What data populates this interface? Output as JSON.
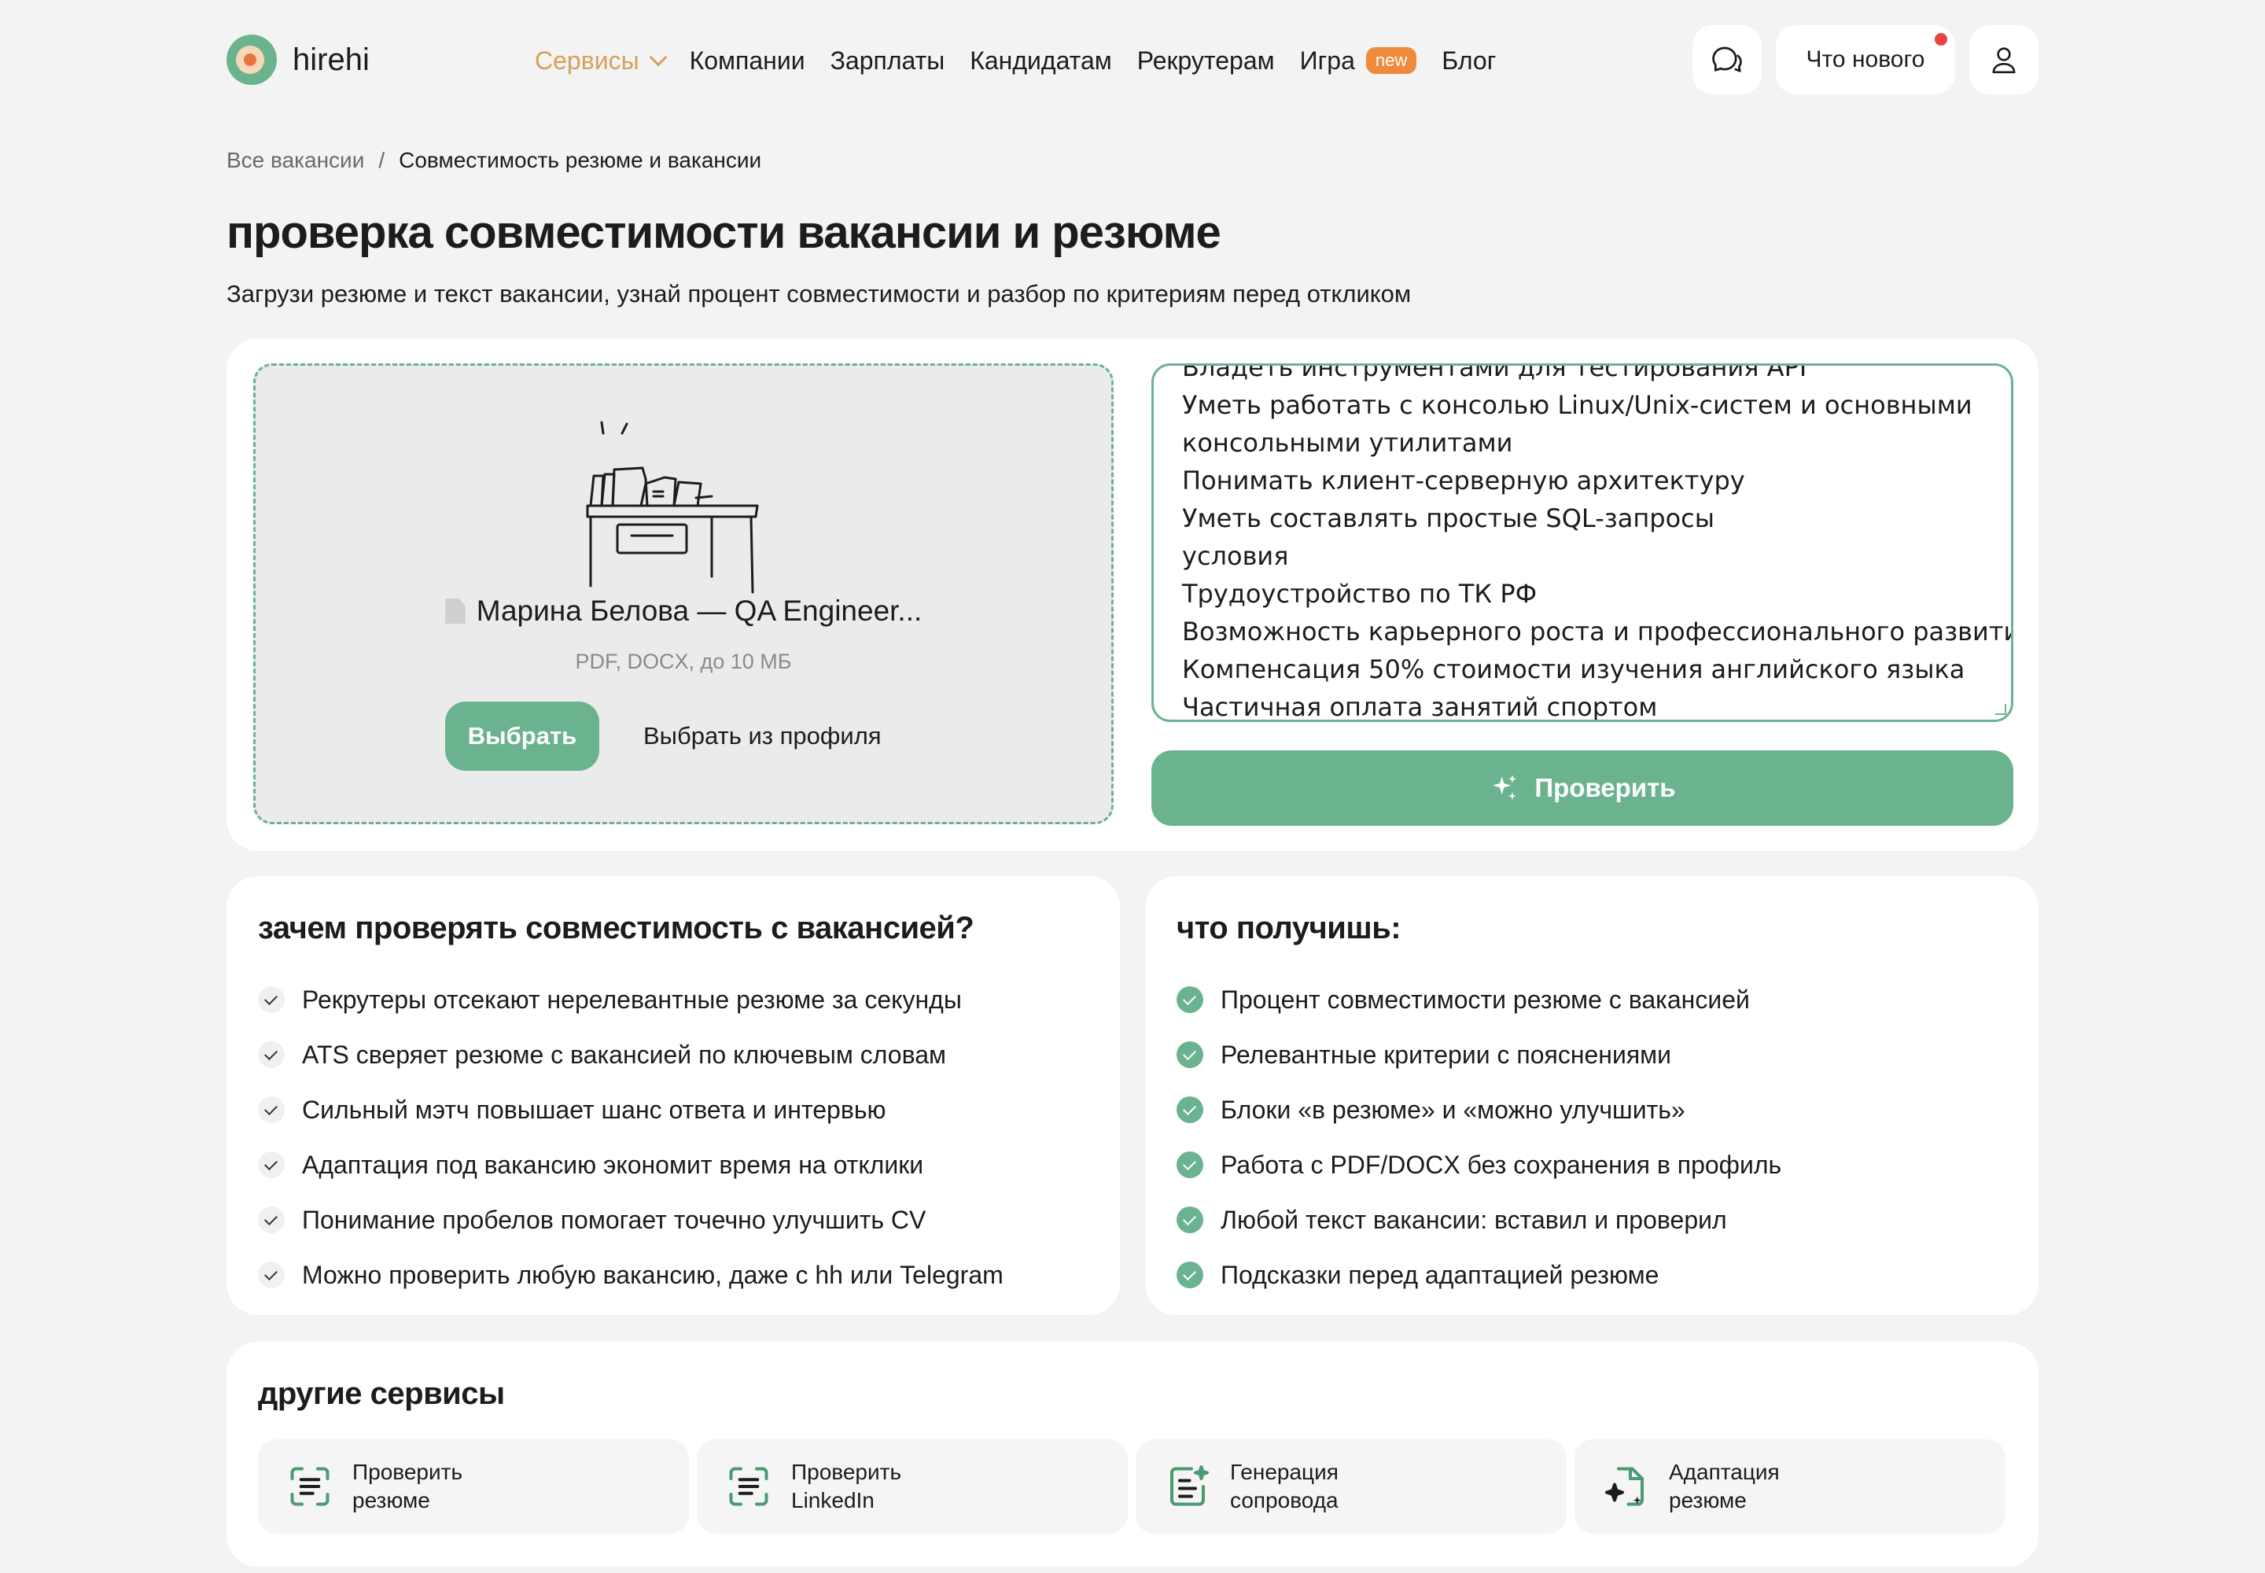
{
  "brand": {
    "name": "hirehi"
  },
  "nav": {
    "items": [
      {
        "label": "Сервисы",
        "active": true
      },
      {
        "label": "Компании"
      },
      {
        "label": "Зарплаты"
      },
      {
        "label": "Кандидатам"
      },
      {
        "label": "Рекрутерам"
      },
      {
        "label": "Игра",
        "badge": "new"
      },
      {
        "label": "Блог"
      }
    ],
    "whats_new": "Что нового"
  },
  "breadcrumb": {
    "root": "Все вакансии",
    "separator": "/",
    "current": "Совместимость резюме и вакансии"
  },
  "page": {
    "title": "проверка совместимости вакансии и резюме",
    "subtitle": "Загрузи резюме и текст вакансии, узнай процент совместимости и разбор по критериям перед откликом"
  },
  "upload": {
    "file_name": "Марина Белова — QA Engineer...",
    "hint": "PDF, DOCX, до 10 МБ",
    "choose_label": "Выбрать",
    "choose_profile_label": "Выбрать из профиля"
  },
  "vacancy_text": {
    "lines": [
      "Владеть инструментами для тестирования API",
      "Уметь работать с консолью Linux/Unix-систем и основными",
      "консольными утилитами",
      "Понимать клиент-серверную архитектуру",
      "Уметь составлять простые SQL-запросы",
      "условия",
      "Трудоустройство по ТК РФ",
      "Возможность карьерного роста и профессионального развития",
      "Компенсация 50% стоимости изучения английского языка",
      "Частичная оплата занятий спортом"
    ]
  },
  "check_button": {
    "label": "Проверить"
  },
  "why": {
    "title": "зачем проверять совместимость с вакансией?",
    "items": [
      "Рекрутеры отсекают нерелевантные резюме за секунды",
      "ATS сверяет резюме с вакансией по ключевым словам",
      "Сильный мэтч повышает шанс ответа и интервью",
      "Адаптация под вакансию экономит время на отклики",
      "Понимание пробелов помогает точечно улучшить CV",
      "Можно проверить любую вакансию, даже с hh или Telegram"
    ]
  },
  "get": {
    "title": "что получишь:",
    "items": [
      "Процент совместимости резюме с вакансией",
      "Релевантные критерии с пояснениями",
      "Блоки «в резюме» и «можно улучшить»",
      "Работа с PDF/DOCX без сохранения в профиль",
      "Любой текст вакансии: вставил и проверил",
      "Подсказки перед адаптацией резюме"
    ]
  },
  "other_services": {
    "title": "другие сервисы",
    "items": [
      {
        "label": "Проверить\nрезюме",
        "icon": "scan-text-icon"
      },
      {
        "label": "Проверить\nLinkedIn",
        "icon": "scan-text-icon"
      },
      {
        "label": "Генерация\nсопровода",
        "icon": "sparkle-doc-icon"
      },
      {
        "label": "Адаптация\nрезюме",
        "icon": "file-sparkle-icon"
      }
    ]
  },
  "colors": {
    "accent": "#6bb38e",
    "nav_active": "#d7a05b",
    "badge": "#ef8a3c",
    "bg": "#f3f3f3"
  }
}
